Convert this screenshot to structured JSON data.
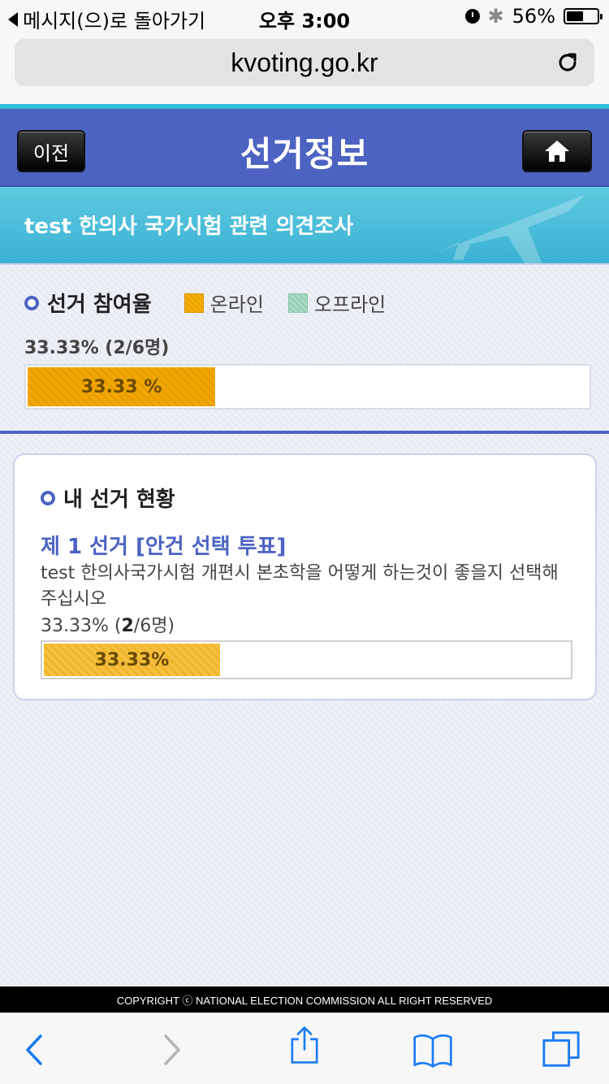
{
  "status_bar": {
    "back_label": "메시지(으)로 돌아가기",
    "time": "오후 3:00",
    "battery": "56%",
    "battery_level": 0.56
  },
  "address_bar": {
    "url": "kvoting.go.kr"
  },
  "header": {
    "title": "선거정보",
    "prev_label": "이전"
  },
  "subject": {
    "title": "test 한의사 국가시험 관련 의견조사"
  },
  "participation": {
    "label": "선거 참여율",
    "legend_online": "온라인",
    "legend_offline": "오프라인",
    "summary": "33.33%  (2/6명)",
    "bar_label": "33.33 %",
    "percent": 33.33
  },
  "my_election": {
    "heading": "내 선거 현황",
    "election_title": "제 1 선거 [안건 선택 투표]",
    "description": "test 한의사국가시험 개편시 본초학을 어떻게 하는것이 좋을지 선택해 주십시오",
    "summary_prefix": "33.33%  (",
    "summary_count": "2",
    "summary_suffix": "/6명)",
    "bar_label": "33.33%",
    "percent": 33.33
  },
  "footer": {
    "copyright": "COPYRIGHT ⓒ NATIONAL ELECTION COMMISSION ALL RIGHT RESERVED"
  },
  "toolbar": {
    "icons": [
      "back-icon",
      "forward-icon",
      "share-icon",
      "bookmarks-icon",
      "tabs-icon"
    ]
  },
  "colors": {
    "header_blue": "#4c63c2",
    "subject_cyan": "#3bb2d2",
    "online_orange": "#f2a800",
    "offline_green": "#a9dcc4"
  }
}
